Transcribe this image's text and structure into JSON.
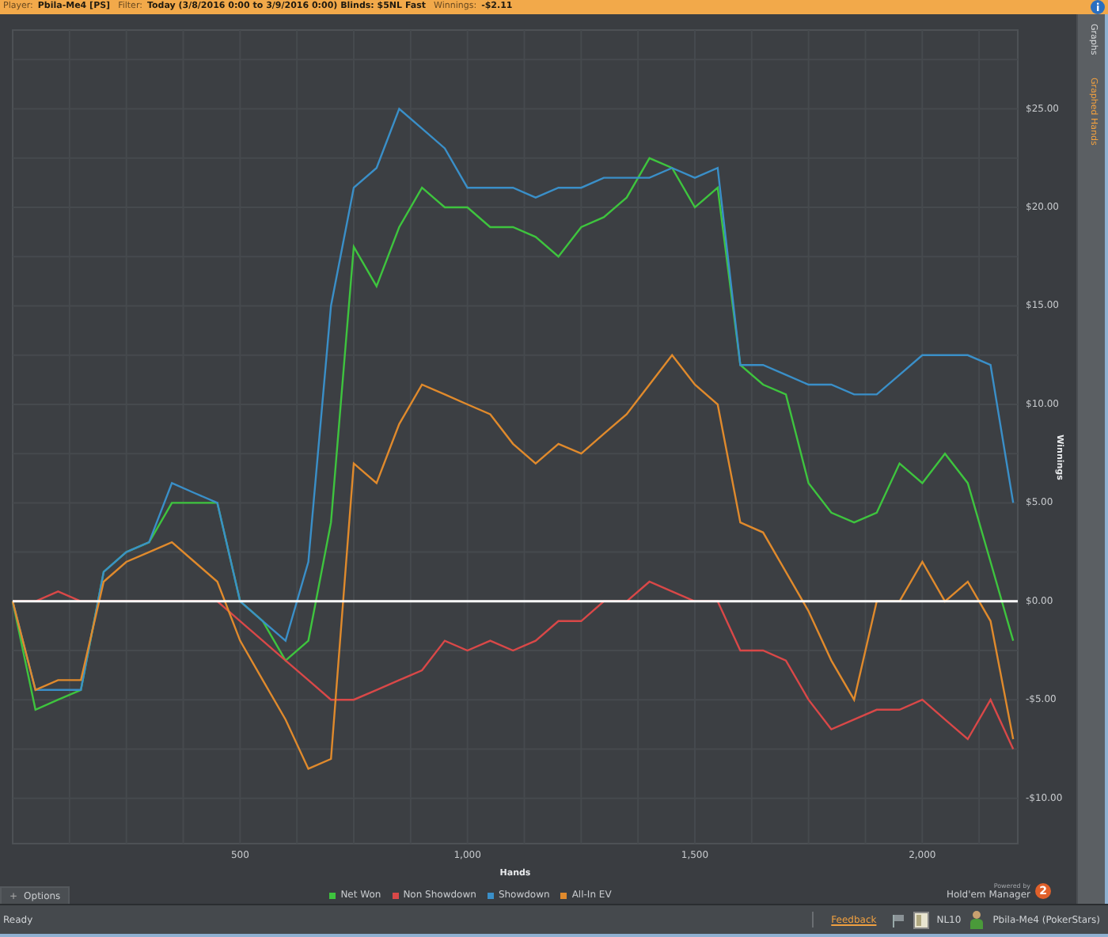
{
  "filter_bar": {
    "player_label": "Player:",
    "player": "Pbila-Me4 [PS]",
    "filter_label": "Filter:",
    "filter": "Today (3/8/2016 0:00 to 3/9/2016 0:00) Blinds: $5NL Fast",
    "winnings_label": "Winnings:",
    "winnings": "-$2.11"
  },
  "side_tabs": [
    {
      "label": "Graphs",
      "selected": false
    },
    {
      "label": "Graphed Hands",
      "selected": true
    }
  ],
  "chart": {
    "chart_data": {
      "type": "line",
      "xlabel": "Hands",
      "ylabel": "Winnings",
      "x": [
        0,
        50,
        100,
        150,
        200,
        250,
        300,
        350,
        400,
        450,
        500,
        550,
        600,
        650,
        700,
        750,
        800,
        850,
        900,
        950,
        1000,
        1050,
        1100,
        1150,
        1200,
        1250,
        1300,
        1350,
        1400,
        1450,
        1500,
        1550,
        1600,
        1650,
        1700,
        1750,
        1800,
        1850,
        1900,
        1950,
        2000,
        2050,
        2100,
        2150,
        2200
      ],
      "xlim": [
        0,
        2210
      ],
      "grid": true,
      "ref_lines": [
        {
          "axis": "y",
          "value": 0,
          "color": "#ffffff"
        }
      ],
      "ylim": [
        -12.3,
        29
      ],
      "xticks": [
        {
          "value": 500,
          "label": "500"
        },
        {
          "value": 1000,
          "label": "1,000"
        },
        {
          "value": 1500,
          "label": "1,500"
        },
        {
          "value": 2000,
          "label": "2,000"
        }
      ],
      "yticks": [
        {
          "value": -10,
          "label": "-$10.00"
        },
        {
          "value": -5,
          "label": "-$5.00"
        },
        {
          "value": 0,
          "label": "$0.00"
        },
        {
          "value": 5,
          "label": "$5.00"
        },
        {
          "value": 10,
          "label": "$10.00"
        },
        {
          "value": 15,
          "label": "$15.00"
        },
        {
          "value": 20,
          "label": "$20.00"
        },
        {
          "value": 25,
          "label": "$25.00"
        }
      ],
      "series": [
        {
          "name": "Net Won",
          "color": "#3ec43e",
          "values": [
            0,
            -5.5,
            -5,
            -4.5,
            1.5,
            2.5,
            3,
            5,
            5,
            5,
            0,
            -1,
            -3,
            -2,
            4,
            18,
            16,
            19,
            21,
            20,
            20,
            19,
            19,
            18.5,
            17.5,
            19,
            19.5,
            20.5,
            22.5,
            22,
            20,
            21,
            12,
            11,
            10.5,
            6,
            4.5,
            4,
            4.5,
            7,
            6,
            7.5,
            6,
            2,
            -2
          ]
        },
        {
          "name": "Non Showdown",
          "color": "#d94848",
          "values": [
            0,
            0,
            0.5,
            0,
            0,
            0,
            0,
            0,
            0,
            0,
            -1,
            -2,
            -3,
            -4,
            -5,
            -5,
            -4.5,
            -4,
            -3.5,
            -2,
            -2.5,
            -2,
            -2.5,
            -2,
            -1,
            -1,
            0,
            0,
            1,
            0.5,
            0,
            0,
            -2.5,
            -2.5,
            -3,
            -5,
            -6.5,
            -6,
            -5.5,
            -5.5,
            -5,
            -6,
            -7,
            -5,
            -7.5
          ]
        },
        {
          "name": "Showdown",
          "color": "#3a8fc8",
          "values": [
            0,
            -4.5,
            -4.5,
            -4.5,
            1.5,
            2.5,
            3,
            6,
            5.5,
            5,
            0,
            -1,
            -2,
            2,
            15,
            21,
            22,
            25,
            24,
            23,
            21,
            21,
            21,
            20.5,
            21,
            21,
            21.5,
            21.5,
            21.5,
            22,
            21.5,
            22,
            12,
            12,
            11.5,
            11,
            11,
            10.5,
            10.5,
            11.5,
            12.5,
            12.5,
            12.5,
            12,
            5
          ]
        },
        {
          "name": "All-In EV",
          "color": "#e08a2c",
          "values": [
            0,
            -4.5,
            -4,
            -4,
            1,
            2,
            2.5,
            3,
            2,
            1,
            -2,
            -4,
            -6,
            -8.5,
            -8,
            7,
            6,
            9,
            11,
            10.5,
            10,
            9.5,
            8,
            7,
            8,
            7.5,
            8.5,
            9.5,
            11,
            12.5,
            11,
            10,
            4,
            3.5,
            1.5,
            -0.5,
            -3,
            -5,
            0,
            0,
            2,
            0,
            1,
            -1,
            -7
          ]
        }
      ]
    }
  },
  "options_tab": {
    "icon": "+",
    "label": "Options"
  },
  "powered_by": {
    "caption": "Powered by",
    "product": "Hold'em Manager",
    "badge": "2"
  },
  "status_bar": {
    "status": "Ready",
    "feedback": "Feedback",
    "stakes": "NL10",
    "account": "Pbila-Me4 (PokerStars)"
  }
}
